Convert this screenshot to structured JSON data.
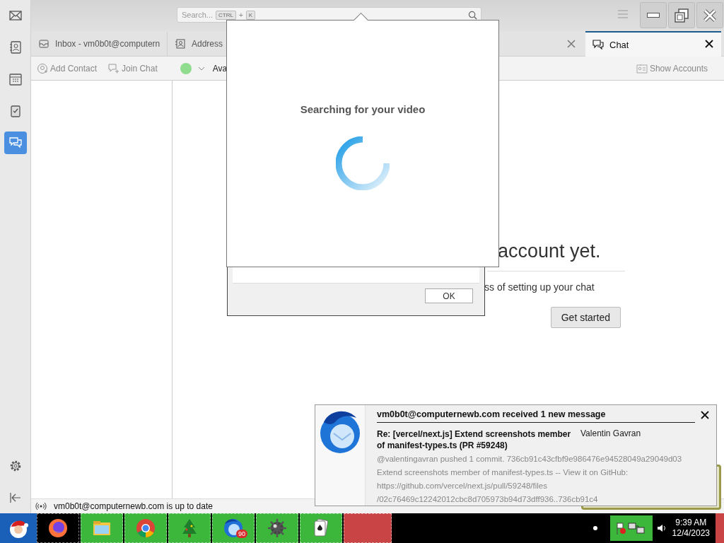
{
  "spaces": [
    {
      "kind": "mail",
      "selected": false
    },
    {
      "kind": "addressbook",
      "selected": false
    },
    {
      "kind": "calendar",
      "selected": false
    },
    {
      "kind": "tasks",
      "selected": false
    },
    {
      "kind": "chat",
      "selected": true
    }
  ],
  "search": {
    "placeholder": "Search...",
    "keys": [
      "CTRL",
      "+",
      "K"
    ]
  },
  "tabs": [
    {
      "kind": "mail",
      "label": "Inbox - vm0b0t@computern",
      "selected": false
    },
    {
      "kind": "addressbook",
      "label": "Address",
      "selected": false
    },
    {
      "kind": "chat",
      "label": "Chat",
      "selected": true
    }
  ],
  "toolbar": {
    "buttons": [
      {
        "kind": "add-contact",
        "label": "Add Contact"
      },
      {
        "kind": "join-chat",
        "label": "Join Chat"
      }
    ],
    "status": {
      "color": "#8fdc8f",
      "label": "Ava"
    },
    "show_accounts": "Show Accounts"
  },
  "chat_intro": {
    "heading": "account yet.",
    "text": "ss of setting up your chat",
    "button": "Get started"
  },
  "status_bar": "vm0b0t@computernewb.com is up to date",
  "dialog": {
    "button": "OK"
  },
  "video_popup": {
    "title": "Searching for your video"
  },
  "notification": {
    "title": "vm0b0t@computernewb.com received 1 new message",
    "subject": "Re: [vercel/next.js] Extend screenshots member of manifest-types.ts (PR #59248)",
    "sender": "Valentin Gavran",
    "preview": [
      "@valentingavran pushed 1 commit. 736cb91c43cfbf9e986476e94528049a29049d03",
      "Extend screenshots member of manifest-types.ts -- View it on GitHub:",
      "https://github.com/vercel/next.js/pull/59248/files",
      "/02c76469c12242012cbc8d705973b94d73dff936..736cb91c4"
    ]
  },
  "taskbar": {
    "apps": [
      {
        "kind": "firefox",
        "color": "#000000"
      },
      {
        "kind": "explorer",
        "color": "#3cb73c"
      },
      {
        "kind": "chrome",
        "color": "#3cb73c"
      },
      {
        "kind": "tree",
        "color": "#3cb73c"
      },
      {
        "kind": "thunderbird",
        "color": "#3cb73c",
        "badge": "90"
      },
      {
        "kind": "mine",
        "color": "#3cb73c"
      },
      {
        "kind": "cards",
        "color": "#3cb73c"
      },
      {
        "kind": "empty",
        "color": "#c94545"
      }
    ],
    "time": "9:39 AM",
    "date": "12/4/2023"
  }
}
